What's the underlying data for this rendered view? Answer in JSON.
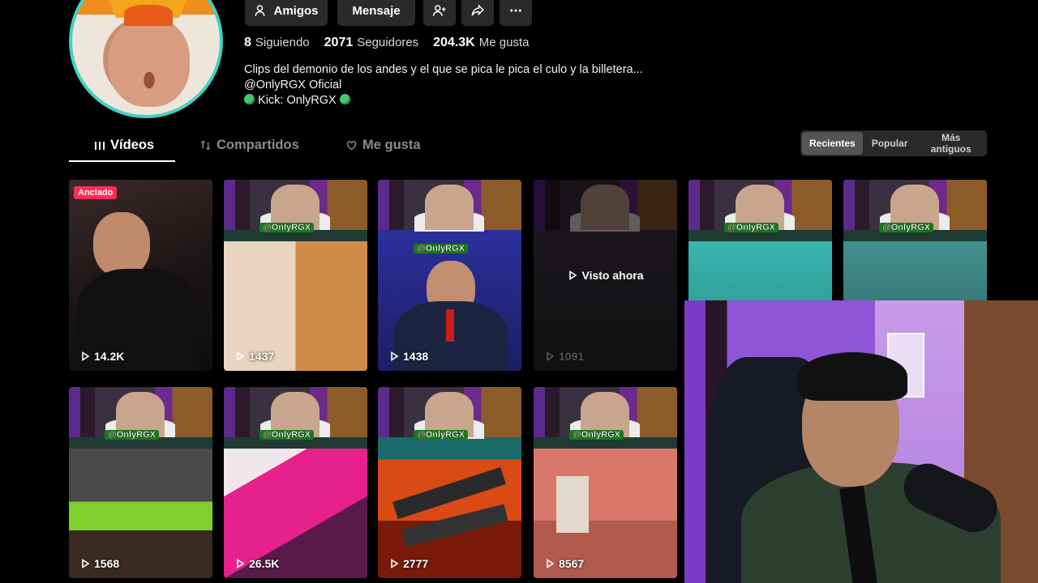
{
  "profile": {
    "buttons": {
      "friends": "Amigos",
      "message": "Mensaje"
    },
    "stats": [
      {
        "value": "8",
        "label": "Siguiendo"
      },
      {
        "value": "2071",
        "label": "Seguidores"
      },
      {
        "value": "204.3K",
        "label": "Me gusta"
      }
    ],
    "bio": {
      "line1": "Clips del demonio de los andes y el que se pica le pica el culo y la billetera...",
      "line2": "@OnlyRGX Oficial",
      "line3": "Kick: OnlyRGX"
    }
  },
  "tabs": [
    {
      "label": "Vídeos",
      "icon": "bars-icon",
      "active": true
    },
    {
      "label": "Compartidos",
      "icon": "repost-icon"
    },
    {
      "label": "Me gusta",
      "icon": "heart-icon"
    }
  ],
  "sort": {
    "options": [
      "Recientes",
      "Popular",
      "Más antiguos"
    ],
    "selected": "Recientes"
  },
  "videos": {
    "pinned_label": "Anclado",
    "watched_label": "Visto ahora",
    "watermark": "@OnlyRGX",
    "items": [
      {
        "views": "14.2K"
      },
      {
        "views": "1437"
      },
      {
        "views": "1438"
      },
      {
        "views": "1091"
      },
      {
        "views": ""
      },
      {
        "views": ""
      },
      {
        "views": "1568"
      },
      {
        "views": "26.5K"
      },
      {
        "views": "2777"
      },
      {
        "views": "8567"
      }
    ]
  },
  "colors": {
    "accent_ring": "#3fd3c4",
    "pinned_badge": "#fe2c55",
    "kick_dot": "#48c774"
  }
}
